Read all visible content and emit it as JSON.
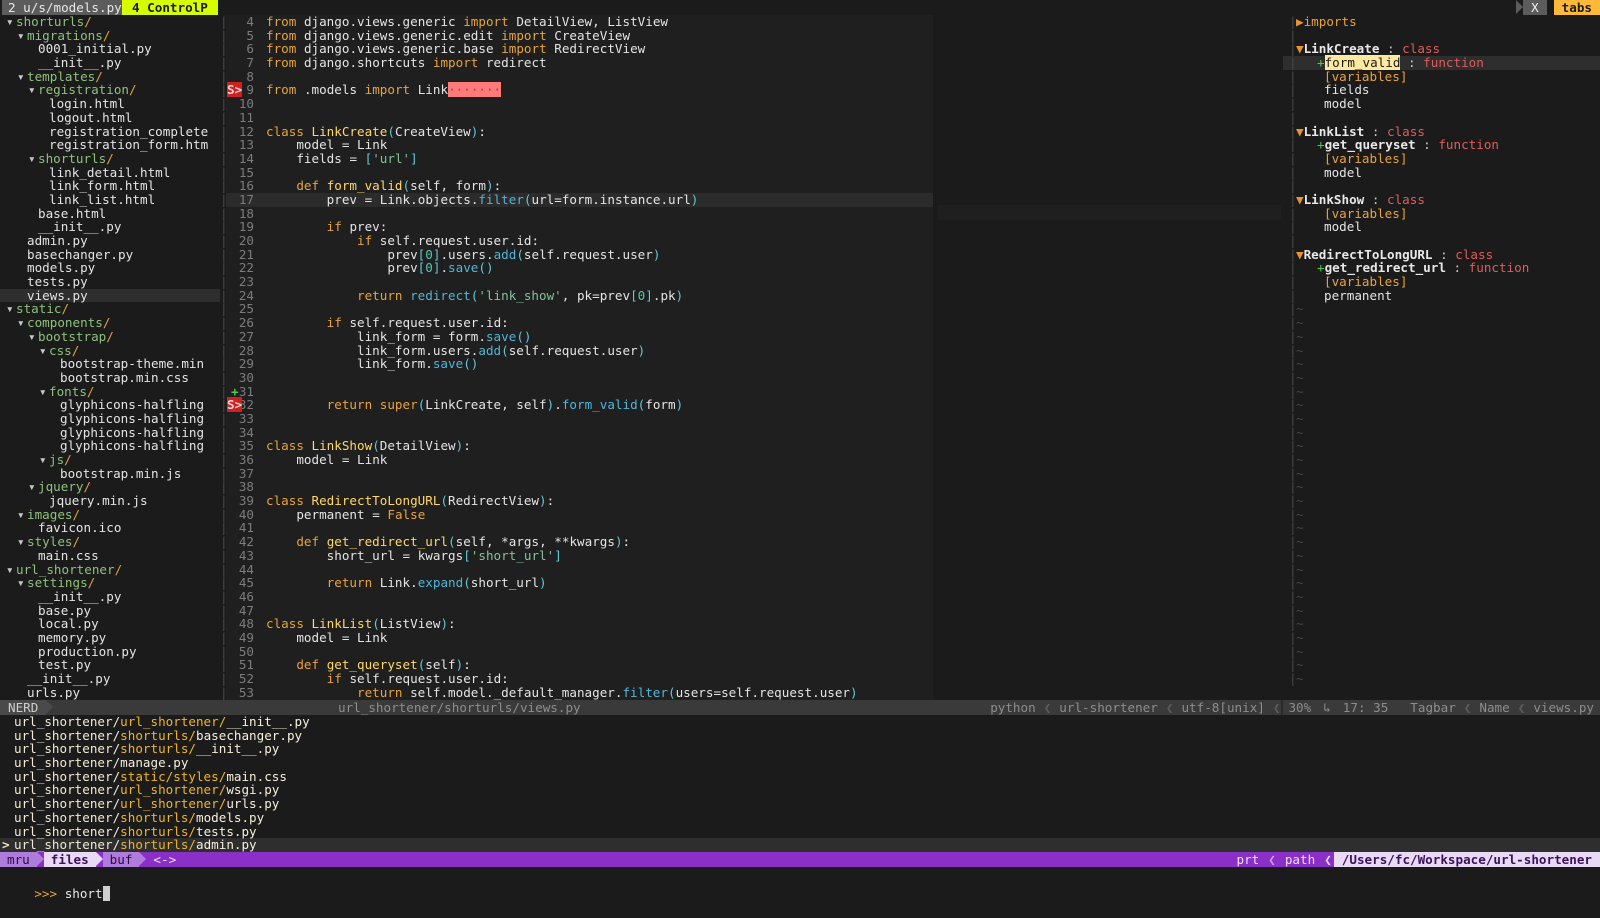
{
  "tabline": {
    "active_tab": "2 u/s/models.py",
    "ctrlp_tab": "4 ControlP",
    "right_close": "X",
    "right_label": "tabs"
  },
  "nerdtree": {
    "rows": [
      {
        "indent": 1,
        "arrow": "▾",
        "name": "shorturls",
        "type": "dir"
      },
      {
        "indent": 2,
        "arrow": "▾",
        "name": "migrations",
        "type": "dir"
      },
      {
        "indent": 3,
        "arrow": "",
        "name": "0001_initial.py",
        "type": "file"
      },
      {
        "indent": 3,
        "arrow": "",
        "name": "__init__.py",
        "type": "file"
      },
      {
        "indent": 2,
        "arrow": "▾",
        "name": "templates",
        "type": "dir"
      },
      {
        "indent": 3,
        "arrow": "▾",
        "name": "registration",
        "type": "dir"
      },
      {
        "indent": 4,
        "arrow": "",
        "name": "login.html",
        "type": "file"
      },
      {
        "indent": 4,
        "arrow": "",
        "name": "logout.html",
        "type": "file"
      },
      {
        "indent": 4,
        "arrow": "",
        "name": "registration_complete",
        "type": "file"
      },
      {
        "indent": 4,
        "arrow": "",
        "name": "registration_form.htm",
        "type": "file"
      },
      {
        "indent": 3,
        "arrow": "▾",
        "name": "shorturls",
        "type": "dir"
      },
      {
        "indent": 4,
        "arrow": "",
        "name": "link_detail.html",
        "type": "file"
      },
      {
        "indent": 4,
        "arrow": "",
        "name": "link_form.html",
        "type": "file"
      },
      {
        "indent": 4,
        "arrow": "",
        "name": "link_list.html",
        "type": "file"
      },
      {
        "indent": 3,
        "arrow": "",
        "name": "base.html",
        "type": "file"
      },
      {
        "indent": 3,
        "arrow": "",
        "name": "__init__.py",
        "type": "file"
      },
      {
        "indent": 2,
        "arrow": "",
        "name": "admin.py",
        "type": "file"
      },
      {
        "indent": 2,
        "arrow": "",
        "name": "basechanger.py",
        "type": "file"
      },
      {
        "indent": 2,
        "arrow": "",
        "name": "models.py",
        "type": "file"
      },
      {
        "indent": 2,
        "arrow": "",
        "name": "tests.py",
        "type": "file"
      },
      {
        "indent": 2,
        "arrow": "",
        "name": "views.py",
        "type": "file",
        "selected": true
      },
      {
        "indent": 1,
        "arrow": "▾",
        "name": "static",
        "type": "dir"
      },
      {
        "indent": 2,
        "arrow": "▾",
        "name": "components",
        "type": "dir"
      },
      {
        "indent": 3,
        "arrow": "▾",
        "name": "bootstrap",
        "type": "dir"
      },
      {
        "indent": 4,
        "arrow": "▾",
        "name": "css",
        "type": "dir"
      },
      {
        "indent": 5,
        "arrow": "",
        "name": "bootstrap-theme.min",
        "type": "file"
      },
      {
        "indent": 5,
        "arrow": "",
        "name": "bootstrap.min.css",
        "type": "file"
      },
      {
        "indent": 4,
        "arrow": "▾",
        "name": "fonts",
        "type": "dir"
      },
      {
        "indent": 5,
        "arrow": "",
        "name": "glyphicons-halfling",
        "type": "file"
      },
      {
        "indent": 5,
        "arrow": "",
        "name": "glyphicons-halfling",
        "type": "file"
      },
      {
        "indent": 5,
        "arrow": "",
        "name": "glyphicons-halfling",
        "type": "file"
      },
      {
        "indent": 5,
        "arrow": "",
        "name": "glyphicons-halfling",
        "type": "file"
      },
      {
        "indent": 4,
        "arrow": "▾",
        "name": "js",
        "type": "dir"
      },
      {
        "indent": 5,
        "arrow": "",
        "name": "bootstrap.min.js",
        "type": "file"
      },
      {
        "indent": 3,
        "arrow": "▾",
        "name": "jquery",
        "type": "dir"
      },
      {
        "indent": 4,
        "arrow": "",
        "name": "jquery.min.js",
        "type": "file"
      },
      {
        "indent": 2,
        "arrow": "▾",
        "name": "images",
        "type": "dir"
      },
      {
        "indent": 3,
        "arrow": "",
        "name": "favicon.ico",
        "type": "file"
      },
      {
        "indent": 2,
        "arrow": "▾",
        "name": "styles",
        "type": "dir"
      },
      {
        "indent": 3,
        "arrow": "",
        "name": "main.css",
        "type": "file"
      },
      {
        "indent": 1,
        "arrow": "▾",
        "name": "url_shortener",
        "type": "dir"
      },
      {
        "indent": 2,
        "arrow": "▾",
        "name": "settings",
        "type": "dir"
      },
      {
        "indent": 3,
        "arrow": "",
        "name": "__init__.py",
        "type": "file"
      },
      {
        "indent": 3,
        "arrow": "",
        "name": "base.py",
        "type": "file"
      },
      {
        "indent": 3,
        "arrow": "",
        "name": "local.py",
        "type": "file"
      },
      {
        "indent": 3,
        "arrow": "",
        "name": "memory.py",
        "type": "file"
      },
      {
        "indent": 3,
        "arrow": "",
        "name": "production.py",
        "type": "file"
      },
      {
        "indent": 3,
        "arrow": "",
        "name": "test.py",
        "type": "file"
      },
      {
        "indent": 2,
        "arrow": "",
        "name": "__init__.py",
        "type": "file"
      },
      {
        "indent": 2,
        "arrow": "",
        "name": "urls.py",
        "type": "file"
      }
    ]
  },
  "editor": {
    "lines": [
      {
        "n": 4,
        "sign": "",
        "text": "from django.views.generic import DetailView, ListView"
      },
      {
        "n": 5,
        "sign": "",
        "text": "from django.views.generic.edit import CreateView"
      },
      {
        "n": 6,
        "sign": "",
        "text": "from django.views.generic.base import RedirectView"
      },
      {
        "n": 7,
        "sign": "",
        "text": "from django.shortcuts import redirect"
      },
      {
        "n": 8,
        "sign": "",
        "text": ""
      },
      {
        "n": 9,
        "sign": "S>",
        "text": "from .models import Link",
        "trailing": "·······"
      },
      {
        "n": 10,
        "sign": "",
        "text": ""
      },
      {
        "n": 11,
        "sign": "",
        "text": ""
      },
      {
        "n": 12,
        "sign": "",
        "text": "class LinkCreate(CreateView):"
      },
      {
        "n": 13,
        "sign": "",
        "text": "    model = Link"
      },
      {
        "n": 14,
        "sign": "",
        "text": "    fields = ['url']"
      },
      {
        "n": 15,
        "sign": "",
        "text": ""
      },
      {
        "n": 16,
        "sign": "",
        "text": "    def form_valid(self, form):"
      },
      {
        "n": 17,
        "sign": "",
        "text": "        prev = Link.objects.filter(url=form.instance.url)",
        "cursor": true
      },
      {
        "n": 18,
        "sign": "",
        "text": ""
      },
      {
        "n": 19,
        "sign": "",
        "text": "        if prev:"
      },
      {
        "n": 20,
        "sign": "",
        "text": "            if self.request.user.id:"
      },
      {
        "n": 21,
        "sign": "",
        "text": "                prev[0].users.add(self.request.user)"
      },
      {
        "n": 22,
        "sign": "",
        "text": "                prev[0].save()"
      },
      {
        "n": 23,
        "sign": "",
        "text": ""
      },
      {
        "n": 24,
        "sign": "",
        "text": "            return redirect('link_show', pk=prev[0].pk)"
      },
      {
        "n": 25,
        "sign": "",
        "text": ""
      },
      {
        "n": 26,
        "sign": "",
        "text": "        if self.request.user.id:"
      },
      {
        "n": 27,
        "sign": "",
        "text": "            link_form = form.save()"
      },
      {
        "n": 28,
        "sign": "",
        "text": "            link_form.users.add(self.request.user)"
      },
      {
        "n": 29,
        "sign": "",
        "text": "            link_form.save()"
      },
      {
        "n": 30,
        "sign": "",
        "text": ""
      },
      {
        "n": 31,
        "sign": "+",
        "text": ""
      },
      {
        "n": 32,
        "sign": "S>",
        "text": "        return super(LinkCreate, self).form_valid(form)"
      },
      {
        "n": 33,
        "sign": "",
        "text": ""
      },
      {
        "n": 34,
        "sign": "",
        "text": ""
      },
      {
        "n": 35,
        "sign": "",
        "text": "class LinkShow(DetailView):"
      },
      {
        "n": 36,
        "sign": "",
        "text": "    model = Link"
      },
      {
        "n": 37,
        "sign": "",
        "text": ""
      },
      {
        "n": 38,
        "sign": "",
        "text": ""
      },
      {
        "n": 39,
        "sign": "",
        "text": "class RedirectToLongURL(RedirectView):"
      },
      {
        "n": 40,
        "sign": "",
        "text": "    permanent = False"
      },
      {
        "n": 41,
        "sign": "",
        "text": ""
      },
      {
        "n": 42,
        "sign": "",
        "text": "    def get_redirect_url(self, *args, **kwargs):"
      },
      {
        "n": 43,
        "sign": "",
        "text": "        short_url = kwargs['short_url']"
      },
      {
        "n": 44,
        "sign": "",
        "text": ""
      },
      {
        "n": 45,
        "sign": "",
        "text": "        return Link.expand(short_url)"
      },
      {
        "n": 46,
        "sign": "",
        "text": ""
      },
      {
        "n": 47,
        "sign": "",
        "text": ""
      },
      {
        "n": 48,
        "sign": "",
        "text": "class LinkList(ListView):"
      },
      {
        "n": 49,
        "sign": "",
        "text": "    model = Link"
      },
      {
        "n": 50,
        "sign": "",
        "text": ""
      },
      {
        "n": 51,
        "sign": "",
        "text": "    def get_queryset(self):"
      },
      {
        "n": 52,
        "sign": "",
        "text": "        if self.request.user.id:"
      },
      {
        "n": 53,
        "sign": "",
        "text": "            return self.model._default_manager.filter(users=self.request.user)"
      }
    ]
  },
  "tagbar": {
    "rows": [
      {
        "fold": "▶",
        "text": "imports",
        "kind": "fold"
      },
      {
        "text": ""
      },
      {
        "fold": "▼",
        "name": "LinkCreate",
        "sep": " : ",
        "kind": "class"
      },
      {
        "plus": "+",
        "name": "form_valid",
        "sep": " : ",
        "kind": "function",
        "highlight": true,
        "selected": true
      },
      {
        "var": "[variables]"
      },
      {
        "child": "fields"
      },
      {
        "child": "model"
      },
      {
        "text": ""
      },
      {
        "fold": "▼",
        "name": "LinkList",
        "sep": " : ",
        "kind": "class"
      },
      {
        "plus": "+",
        "name": "get_queryset",
        "sep": " : ",
        "kind": "function"
      },
      {
        "var": "[variables]"
      },
      {
        "child": "model"
      },
      {
        "text": ""
      },
      {
        "fold": "▼",
        "name": "LinkShow",
        "sep": " : ",
        "kind": "class"
      },
      {
        "var": "[variables]"
      },
      {
        "child": "model"
      },
      {
        "text": ""
      },
      {
        "fold": "▼",
        "name": "RedirectToLongURL",
        "sep": " : ",
        "kind": "class"
      },
      {
        "plus": "+",
        "name": "get_redirect_url",
        "sep": " : ",
        "kind": "function"
      },
      {
        "var": "[variables]"
      },
      {
        "child": "permanent"
      }
    ],
    "tilde_count": 28
  },
  "statusline": {
    "left_mode": "NERD",
    "path": "url_shortener/shorturls/views.py",
    "filetype": "python",
    "branch": "url-shortener",
    "encoding": "utf-8[unix]",
    "percent": "30%",
    "position": "17: 35",
    "tagbar_label": "Tagbar",
    "tagbar_name": "Name",
    "tagbar_file": "views.py"
  },
  "ctrlp": {
    "results": [
      {
        "dir": "url_shortener/",
        "mid": "url_shortener/",
        "file": "__init__.py"
      },
      {
        "dir": "url_shortener/",
        "mid": "shorturls/",
        "file": "basechanger.py"
      },
      {
        "dir": "url_shortener/",
        "mid": "shorturls/",
        "file": "__init__.py"
      },
      {
        "dir": "url_shortener/",
        "mid": "",
        "file": "manage.py"
      },
      {
        "dir": "url_shortener/",
        "mid": "static/styles/",
        "file": "main.css"
      },
      {
        "dir": "url_shortener/",
        "mid": "url_shortener/",
        "file": "wsgi.py"
      },
      {
        "dir": "url_shortener/",
        "mid": "url_shortener/",
        "file": "urls.py"
      },
      {
        "dir": "url_shortener/",
        "mid": "shorturls/",
        "file": "models.py"
      },
      {
        "dir": "url_shortener/",
        "mid": "shorturls/",
        "file": "tests.py"
      },
      {
        "dir": "url_shortener/",
        "mid": "shorturls/",
        "file": "admin.py",
        "selected": true,
        "marker": ">"
      }
    ],
    "statusbar": {
      "mru": "mru",
      "files": "files",
      "buf": "buf",
      "arrows": "<->",
      "prt": "prt",
      "path_label": "path",
      "cwd": "/Users/fc/Workspace/url-shortener"
    },
    "prompt_prefix": ">>>",
    "prompt_value": "short"
  }
}
